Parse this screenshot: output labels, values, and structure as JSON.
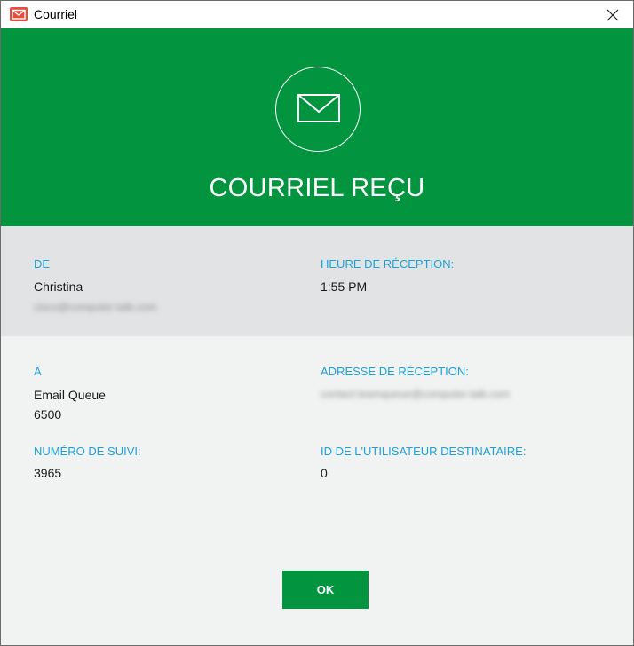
{
  "window": {
    "title": "Courriel",
    "close_glyph": "✕",
    "icon": "mail-app-icon"
  },
  "banner": {
    "icon": "envelope-icon",
    "title": "COURRIEL REÇU",
    "color": "#02943f"
  },
  "from": {
    "label": "DE",
    "name": "Christina",
    "email": "[blurred email address]"
  },
  "received_time": {
    "label": "HEURE DE RÉCEPTION:",
    "value": "1:55 PM"
  },
  "to": {
    "label": "À",
    "name": "Email Queue",
    "id": "6500"
  },
  "receiving_address": {
    "label": "ADRESSE DE RÉCEPTION:",
    "value": "[blurred email address]"
  },
  "tracking_number": {
    "label": "NUMÉRO DE SUIVI:",
    "value": "3965"
  },
  "recipient_user_id": {
    "label": "ID DE L'UTILISATEUR DESTINATAIRE:",
    "value": "0"
  },
  "actions": {
    "ok_label": "OK"
  },
  "colors": {
    "accent": "#02943f",
    "label_blue": "#1ea0d8",
    "sender_bg": "#e2e3e5",
    "body_bg": "#f1f2f2"
  }
}
